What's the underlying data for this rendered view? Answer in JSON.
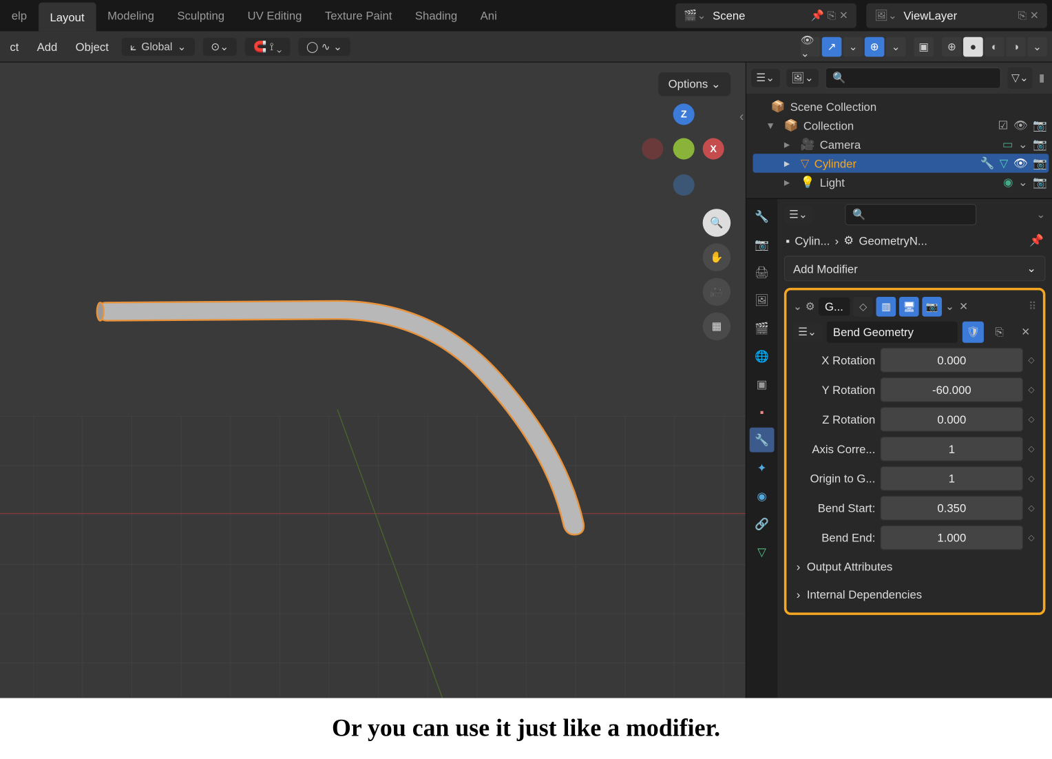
{
  "workspaces": {
    "help": "elp",
    "tabs": [
      "Layout",
      "Modeling",
      "Sculpting",
      "UV Editing",
      "Texture Paint",
      "Shading",
      "Ani"
    ],
    "active_tab": "Layout"
  },
  "scene_name": "Scene",
  "viewlayer_name": "ViewLayer",
  "header": {
    "ct": "ct",
    "add": "Add",
    "object": "Object",
    "orientation": "Global",
    "options_label": "Options"
  },
  "gizmo": {
    "z": "Z",
    "x": "X"
  },
  "outliner": {
    "root": "Scene Collection",
    "collection": "Collection",
    "items": [
      {
        "name": "Camera",
        "icon": "camera"
      },
      {
        "name": "Cylinder",
        "icon": "mesh",
        "selected": true
      },
      {
        "name": "Light",
        "icon": "light"
      }
    ]
  },
  "properties": {
    "object_bc": "Cylin...",
    "modifier_bc": "GeometryN...",
    "add_modifier_label": "Add Modifier",
    "modifier_name_short": "G...",
    "nodegroup_name": "Bend Geometry",
    "fields": [
      {
        "label": "X Rotation",
        "value": "0.000"
      },
      {
        "label": "Y Rotation",
        "value": "-60.000"
      },
      {
        "label": "Z Rotation",
        "value": "0.000"
      },
      {
        "label": "Axis Corre...",
        "value": "1"
      },
      {
        "label": "Origin to G...",
        "value": "1"
      },
      {
        "label": "Bend Start:",
        "value": "0.350"
      },
      {
        "label": "Bend End:",
        "value": "1.000"
      }
    ],
    "sections": [
      "Output Attributes",
      "Internal Dependencies"
    ]
  },
  "caption": "Or you can use it just like a modifier."
}
